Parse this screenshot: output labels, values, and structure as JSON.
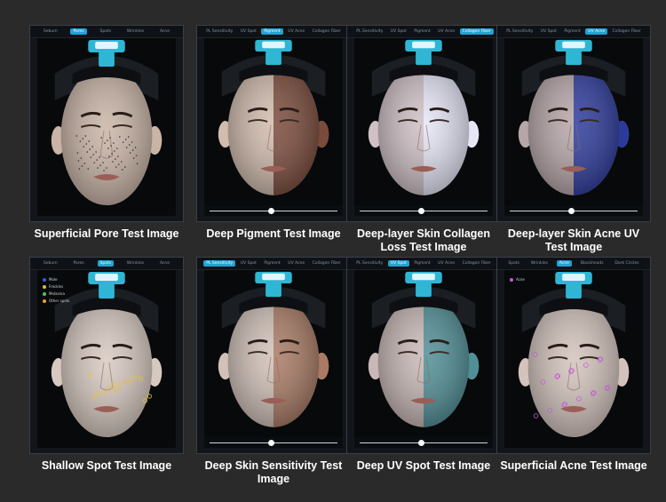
{
  "panels": [
    {
      "caption": "Superficial Pore Test Image",
      "tabs": [
        "Sebum",
        "Pores",
        "Spots",
        "Wrinkles",
        "Acne"
      ],
      "active_tab": 1,
      "slider": false,
      "tint_left": "#c9b4a6",
      "tint_right": "#c9b4a6"
    },
    {
      "caption": "Deep Pigment Test Image",
      "tabs": [
        "PL Sensitivity",
        "UV Spot",
        "Pigment",
        "UV Acne",
        "Collagen Fiber"
      ],
      "active_tab": 2,
      "slider": true,
      "tint_left": "#d2bcae",
      "tint_right": "#7a4a3a"
    },
    {
      "caption": "Deep-layer Skin Collagen Loss Test Image",
      "tabs": [
        "PL Sensitivity",
        "UV Spot",
        "Pigment",
        "UV Acne",
        "Collagen Fiber"
      ],
      "active_tab": 4,
      "slider": true,
      "tint_left": "#cfc0c6",
      "tint_right": "#e6e6f7"
    },
    {
      "caption": "Deep-layer Skin Acne UV Test Image",
      "tabs": [
        "PL Sensitivity",
        "UV Spot",
        "Pigment",
        "UV Acne",
        "Collagen Fiber"
      ],
      "active_tab": 3,
      "slider": true,
      "tint_left": "#b7a6a8",
      "tint_right": "#2c3a9c"
    },
    {
      "caption": "Shallow Spot Test Image",
      "tabs": [
        "Sebum",
        "Pores",
        "Spots",
        "Wrinkles",
        "Acne"
      ],
      "active_tab": 2,
      "slider": false,
      "legend": [
        {
          "label": "Mole",
          "color": "#3b5bd6"
        },
        {
          "label": "Freckles",
          "color": "#d9c431"
        },
        {
          "label": "Melasma",
          "color": "#4fc46a"
        },
        {
          "label": "Other spots",
          "color": "#e9a23a"
        }
      ],
      "tint_left": "#d7c9c0",
      "tint_right": "#d7c9c0"
    },
    {
      "caption": "Deep Skin Sensitivity Test Image",
      "tabs": [
        "PL Sensitivity",
        "UV Spot",
        "Pigment",
        "UV Acne",
        "Collagen Fiber"
      ],
      "active_tab": 0,
      "slider": true,
      "tint_left": "#d1c1b8",
      "tint_right": "#a97a64"
    },
    {
      "caption": "Deep UV Spot Test Image",
      "tabs": [
        "PL Sensitivity",
        "UV Spot",
        "Pigment",
        "UV Acne",
        "Collagen Fiber"
      ],
      "active_tab": 1,
      "slider": true,
      "tint_left": "#c8b8b6",
      "tint_right": "#4f8f96"
    },
    {
      "caption": "Superficial Acne Test Image",
      "tabs": [
        "Spots",
        "Wrinkles",
        "Acne",
        "Blackheads",
        "Dark Circles"
      ],
      "active_tab": 2,
      "slider": false,
      "legend": [
        {
          "label": "Acne",
          "color": "#c45bd6"
        }
      ],
      "tint_left": "#d3c3bc",
      "tint_right": "#d3c3bc"
    }
  ]
}
